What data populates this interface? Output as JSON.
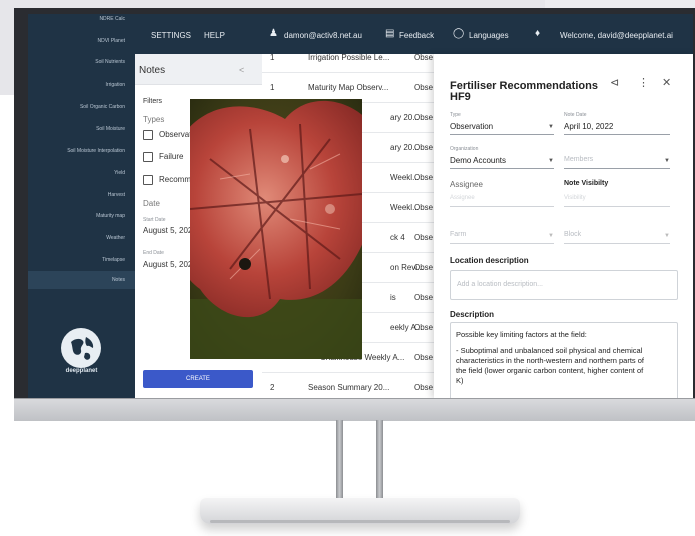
{
  "sidebar": {
    "items": [
      "NDRE Calc",
      "NDVI Planet",
      "Soil Nutrients",
      "Irrigation",
      "Soil Organic Carbon",
      "Soil Moisture",
      "Soil Moisture Interpolation",
      "Yield",
      "Harvest",
      "Maturity map",
      "Weather",
      "Timelapse",
      "Notes"
    ],
    "active": "Notes",
    "brand": "deepplanet"
  },
  "topbar": {
    "settings": "SETTINGS",
    "help": "HELP",
    "account": "damon@activ8.net.au",
    "feedback": "Feedback",
    "languages": "Languages",
    "welcome": "Welcome, david@deepplanet.ai"
  },
  "notes_panel": {
    "title": "Notes",
    "collapse": "<",
    "filters": "Filters",
    "types": "Types",
    "type_options": [
      "Observati",
      "Failure",
      "Recomm"
    ],
    "date": "Date",
    "start_label": "Start Date",
    "start_value": "August 5, 202",
    "end_label": "End Date",
    "end_value": "August 5, 202",
    "create": "CREATE"
  },
  "list": {
    "rows": [
      {
        "num": "1",
        "name": "Irrigation Possible Le...",
        "type": "Obse"
      },
      {
        "num": "1",
        "name": "Maturity Map Observ...",
        "type": "Obse"
      },
      {
        "num": "",
        "name": "ary 20...",
        "type": "Obse"
      },
      {
        "num": "",
        "name": "ary 20...",
        "type": "Obse"
      },
      {
        "num": "",
        "name": "Weekl...",
        "type": "Obse"
      },
      {
        "num": "",
        "name": "Weekl...",
        "type": "Obse"
      },
      {
        "num": "",
        "name": "ck 4",
        "type": "Obse"
      },
      {
        "num": "",
        "name": "on Revi...",
        "type": "Obse"
      },
      {
        "num": "",
        "name": "is",
        "type": "Obse"
      },
      {
        "num": "",
        "name": "eekly A...",
        "type": "Obse"
      },
      {
        "num": "",
        "name": "Chalkhouse Weekly A...",
        "type": "Obse"
      },
      {
        "num": "2",
        "name": "Season Summary 20...",
        "type": "Obse"
      }
    ]
  },
  "details": {
    "title_line1": "Fertiliser Recommendations",
    "title_line2": "HF9",
    "type_label": "Type",
    "type_value": "Observation",
    "date_label": "Note Date",
    "date_value": "April 10, 2022",
    "org_label": "Organization",
    "org_value": "Demo Accounts",
    "members_placeholder": "Members",
    "assignee": "Assignee",
    "assignee_placeholder": "Assignee",
    "visibility": "Note Visibilty",
    "visibility_placeholder": "Visibility",
    "farm_placeholder": "Farm",
    "block_placeholder": "Block",
    "location_heading": "Location description",
    "location_placeholder": "Add a location description...",
    "description_heading": "Description",
    "description_p1": "Possible key limiting factors at the field:",
    "description_p2": "- Suboptimal and unbalanced soil physical and chemical characteristics in the north-western and northern parts of the field (lower organic carbon content, higher content of K)"
  },
  "colors": {
    "sidebar": "#1f3345",
    "accent": "#3b59c9",
    "screen_bg": "#f2f3f5"
  }
}
